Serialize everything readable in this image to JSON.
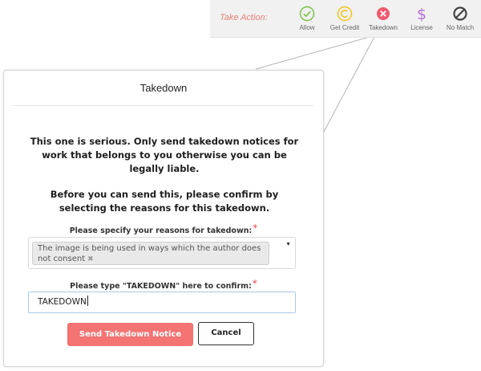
{
  "toolbar": {
    "title": "Take Action:",
    "actions": [
      {
        "label": "Allow",
        "icon": "check-circle-icon",
        "color": "#7bc24a"
      },
      {
        "label": "Get Credit",
        "icon": "copyright-icon",
        "color": "#f2c31d"
      },
      {
        "label": "Takedown",
        "icon": "x-circle-icon",
        "color": "#f05a6e"
      },
      {
        "label": "License",
        "icon": "dollar-icon",
        "color": "#b86fd8"
      },
      {
        "label": "No Match",
        "icon": "no-symbol-icon",
        "color": "#444444"
      }
    ]
  },
  "modal": {
    "title": "Takedown",
    "warning_1": "This one is serious. Only send takedown notices for work that belongs to you otherwise you can be legally liable.",
    "warning_2": "Before you can send this, please confirm by selecting the reasons for this takedown.",
    "reasons_label": "Please specify your reasons for takedown:",
    "required_mark": "*",
    "selected_reason": "The image is being used in ways which the author does not consent",
    "chip_remove": "✖",
    "dropdown_arrow": "▼",
    "confirm_label": "Please type \"TAKEDOWN\" here to confirm:",
    "confirm_value": "TAKEDOWN",
    "send_button": "Send Takedown Notice",
    "cancel_button": "Cancel"
  },
  "colors": {
    "accent": "#f47373",
    "required": "#e64a4a",
    "toolbar_title": "#e8807a"
  }
}
